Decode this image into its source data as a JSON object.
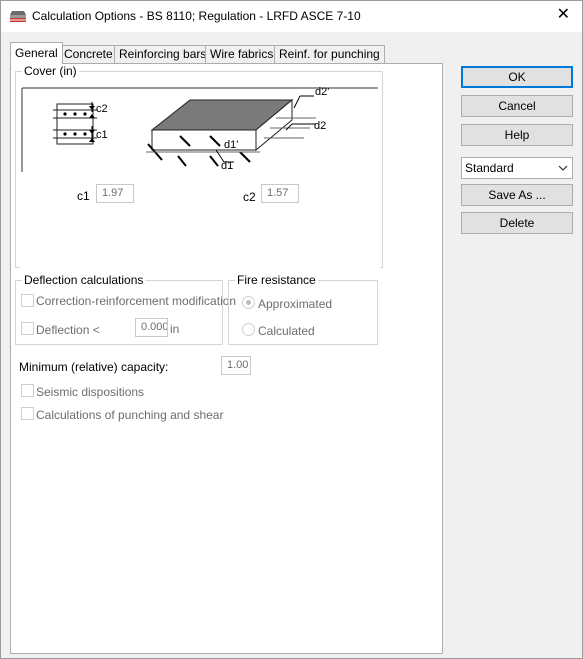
{
  "window": {
    "title": "Calculation Options - BS 8110;  Regulation - LRFD ASCE 7-10",
    "close_glyph": "✕"
  },
  "tabs": [
    "General",
    "Concrete",
    "Reinforcing bars",
    "Wire fabrics",
    "Reinf. for punching"
  ],
  "cover": {
    "title": "Cover (in)",
    "labels": {
      "c1": "c1",
      "c2": "c2",
      "d1": "d1",
      "d1p": "d1'",
      "d2": "d2",
      "d2p": "d2'"
    },
    "c1_label": "c1",
    "c1_value": "1.97",
    "c2_label": "c2",
    "c2_value": "1.57"
  },
  "deflection": {
    "title": "Deflection calculations",
    "correction_label": "Correction-reinforcement modification",
    "deflection_label": "Deflection <",
    "deflection_value": "0.000",
    "deflection_unit": "in"
  },
  "fire": {
    "title": "Fire resistance",
    "approximated_label": "Approximated",
    "calculated_label": "Calculated"
  },
  "min_capacity": {
    "label": "Minimum (relative) capacity:",
    "value": "1.00"
  },
  "options": {
    "seismic_label": "Seismic dispositions",
    "punching_label": "Calculations of punching and shear"
  },
  "buttons": {
    "ok": "OK",
    "cancel": "Cancel",
    "help": "Help",
    "standard": "Standard",
    "save_as": "Save As ...",
    "delete": "Delete"
  }
}
